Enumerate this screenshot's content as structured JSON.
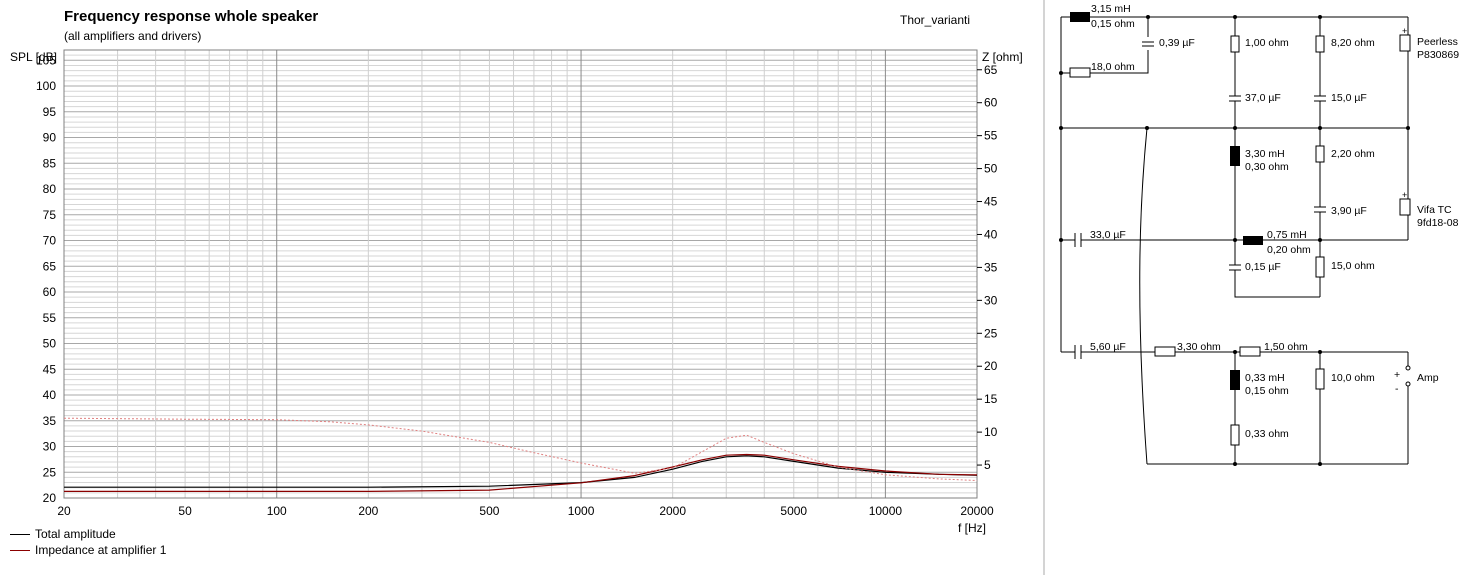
{
  "chart_data": {
    "type": "line",
    "title": "Frequency response whole speaker",
    "subtitle": "(all amplifiers and drivers)",
    "project_name": "Thor_varianti",
    "xlabel": "f [Hz]",
    "ylabel": "SPL [dB]",
    "y2label": "Z [ohm]",
    "x_scale": "log",
    "xlim": [
      20,
      20000
    ],
    "ylim": [
      20,
      107
    ],
    "y2lim": [
      0,
      68
    ],
    "x_ticks": [
      20,
      50,
      100,
      200,
      500,
      1000,
      2000,
      5000,
      10000,
      20000
    ],
    "x_tick_labels": [
      "20",
      "50",
      "100",
      "200",
      "500",
      "1000",
      "2000",
      "5000",
      "10000",
      "20000"
    ],
    "y_ticks": [
      20,
      25,
      30,
      35,
      40,
      45,
      50,
      55,
      60,
      65,
      70,
      75,
      80,
      85,
      90,
      95,
      100,
      105
    ],
    "y2_ticks": [
      5,
      10,
      15,
      20,
      25,
      30,
      35,
      40,
      45,
      50,
      55,
      60,
      65
    ],
    "grid": true,
    "legend_position": "bottom-left",
    "series": [
      {
        "name": "Total amplitude",
        "color": "#000000",
        "axis": "left",
        "x": [
          20,
          200,
          500,
          1000,
          1500,
          2000,
          2500,
          3000,
          3500,
          4000,
          5000,
          7000,
          10000,
          15000,
          20000
        ],
        "values": [
          22.1,
          22.1,
          22.3,
          23.0,
          24.0,
          25.6,
          27.1,
          28.0,
          28.2,
          28.0,
          27.1,
          25.8,
          25.0,
          24.6,
          24.4
        ]
      },
      {
        "name": "Impedance at amplifier 1",
        "color": "#8b0000",
        "axis": "right",
        "x": [
          20,
          200,
          500,
          1000,
          1500,
          2000,
          2500,
          3000,
          3500,
          4000,
          5000,
          7000,
          10000,
          15000,
          20000
        ],
        "values": [
          1.0,
          1.0,
          1.2,
          2.3,
          3.4,
          4.7,
          5.8,
          6.5,
          6.6,
          6.5,
          5.8,
          4.8,
          4.1,
          3.6,
          3.5
        ]
      },
      {
        "name": "",
        "color": "#e08080",
        "style": "dotted",
        "axis": "left",
        "x": [
          20,
          50,
          100,
          150,
          200,
          300,
          500,
          700,
          1000,
          1500,
          2000,
          2500,
          3000,
          3500,
          4000,
          5000,
          7000,
          10000,
          15000,
          20000
        ],
        "values": [
          35.5,
          35.3,
          35.2,
          34.8,
          34.2,
          33.0,
          30.8,
          28.8,
          26.8,
          24.8,
          25.8,
          29.0,
          31.6,
          32.2,
          30.8,
          28.6,
          26.0,
          24.5,
          23.7,
          23.4
        ]
      }
    ]
  },
  "legend": {
    "total_amplitude": "Total amplitude",
    "impedance": "Impedance at amplifier 1"
  },
  "schematic": {
    "components": {
      "l1_value": "3,15 mH",
      "l1_res": "0,15 ohm",
      "c1": "0,39 µF",
      "r1": "18,0 ohm",
      "r2": "1,00 ohm",
      "c2": "37,0 µF",
      "r3": "8,20 ohm",
      "c3": "15,0 µF",
      "l2_value": "3,30 mH",
      "l2_res": "0,30 ohm",
      "r4": "2,20 ohm",
      "c4": "3,90 µF",
      "c5": "33,0 µF",
      "l3_value": "0,75 mH",
      "l3_res": "0,20 ohm",
      "c6": "0,15 µF",
      "r5": "15,0 ohm",
      "c7": "5,60 µF",
      "r6": "3,30 ohm",
      "r7": "1,50 ohm",
      "l4_value": "0,33 mH",
      "l4_res": "0,15 ohm",
      "r8": "10,0 ohm",
      "r9": "0,33 ohm"
    },
    "drivers": {
      "tweeter_name": "Peerless",
      "tweeter_model": "P830869",
      "mid_name": "Vifa TC",
      "mid_model": "9fd18-08"
    },
    "amp_label": "Amp",
    "plus": "+",
    "minus": "-"
  }
}
